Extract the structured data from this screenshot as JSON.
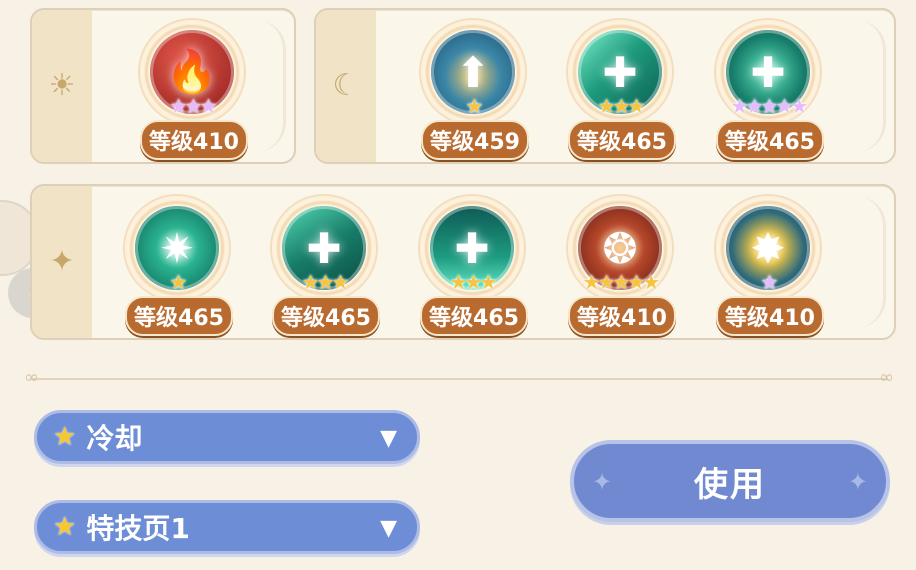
{
  "panel_sun": {
    "tab_icon": "sun-icon",
    "tab_glyph": "☀",
    "skills": [
      {
        "level_label": "等级410",
        "stars": "★★★",
        "star_color": "purple",
        "glyph": "🔥",
        "bg": "#b8322a"
      }
    ]
  },
  "panel_moon": {
    "tab_icon": "moon-icon",
    "tab_glyph": "☾",
    "skills": [
      {
        "level_label": "等级459",
        "stars": "★",
        "star_color": "gold",
        "glyph": "⬆",
        "bg": "#2e7fa0"
      },
      {
        "level_label": "等级465",
        "stars": "★★★",
        "star_color": "gold",
        "glyph": "✚",
        "bg": "#1d9d86"
      },
      {
        "level_label": "等级465",
        "stars": "★★★★★",
        "star_color": "purple",
        "glyph": "✚",
        "bg": "#1a8d79"
      }
    ]
  },
  "panel_star": {
    "tab_icon": "sparkle-icon",
    "tab_glyph": "✦",
    "skills": [
      {
        "level_label": "等级465",
        "stars": "★",
        "star_color": "gold",
        "glyph": "✷",
        "bg": "#138a72"
      },
      {
        "level_label": "等级465",
        "stars": "★★★",
        "star_color": "gold",
        "glyph": "✚",
        "bg": "#1d7d6e"
      },
      {
        "level_label": "等级465",
        "stars": "★★★",
        "star_color": "gold",
        "glyph": "✚",
        "bg": "#1b7e6a"
      },
      {
        "level_label": "等级410",
        "stars": "★★★★★",
        "star_color": "gold",
        "glyph": "❂",
        "bg": "#a9321f"
      },
      {
        "level_label": "等级410",
        "stars": "★",
        "star_color": "purple",
        "glyph": "✸",
        "bg": "#2f6e80"
      }
    ]
  },
  "dropdown_1": {
    "label": "冷却",
    "star_icon": "star-icon",
    "chevron": "▼"
  },
  "dropdown_2": {
    "label": "特技页1",
    "star_icon": "star-icon",
    "chevron": "▼"
  },
  "use_button": {
    "label": "使用"
  },
  "side_nav": {
    "arrow": "‹"
  },
  "colors": {
    "background": "#f8f2e6",
    "badge": "#b96a2f",
    "button": "#7089d0",
    "star_gold": "#f5c542",
    "star_purple": "#e7b9ff"
  }
}
